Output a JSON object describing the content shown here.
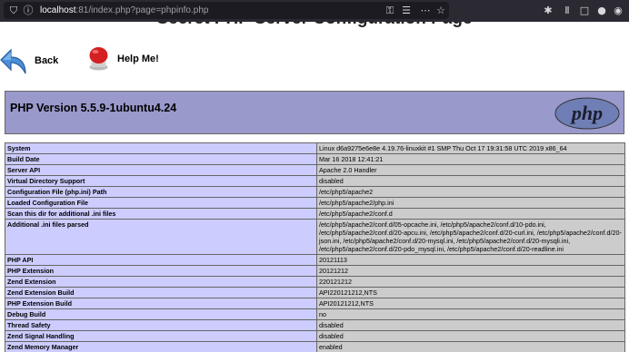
{
  "browser": {
    "url_host": "localhost",
    "url_rest": ":81/index.php?page=phpinfo.php",
    "icons": [
      "shield-icon",
      "info-icon",
      "key-icon",
      "reader-icon",
      "more-icon",
      "star-icon",
      "extensions-icon",
      "library-icon",
      "sidebar-icon",
      "firefox-icon",
      "account-icon"
    ]
  },
  "page": {
    "title": "Secret PHP Server Configuration Page",
    "back_label": "Back",
    "help_label": "Help Me!",
    "version": "PHP Version 5.5.9-1ubuntu4.24",
    "logo_text": "php"
  },
  "info_rows": [
    {
      "key": "System",
      "value": "Linux d6a9275e6e8e 4.19.76-linuxkit #1 SMP Thu Oct 17 19:31:58 UTC 2019 x86_64"
    },
    {
      "key": "Build Date",
      "value": "Mar 16 2018 12:41:21"
    },
    {
      "key": "Server API",
      "value": "Apache 2.0 Handler"
    },
    {
      "key": "Virtual Directory Support",
      "value": "disabled"
    },
    {
      "key": "Configuration File (php.ini) Path",
      "value": "/etc/php5/apache2"
    },
    {
      "key": "Loaded Configuration File",
      "value": "/etc/php5/apache2/php.ini"
    },
    {
      "key": "Scan this dir for additional .ini files",
      "value": "/etc/php5/apache2/conf.d"
    },
    {
      "key": "Additional .ini files parsed",
      "value": "/etc/php5/apache2/conf.d/05-opcache.ini, /etc/php5/apache2/conf.d/10-pdo.ini, /etc/php5/apache2/conf.d/20-apcu.ini, /etc/php5/apache2/conf.d/20-curl.ini, /etc/php5/apache2/conf.d/20-json.ini, /etc/php5/apache2/conf.d/20-mysql.ini, /etc/php5/apache2/conf.d/20-mysqli.ini, /etc/php5/apache2/conf.d/20-pdo_mysql.ini, /etc/php5/apache2/conf.d/20-readline.ini"
    },
    {
      "key": "PHP API",
      "value": "20121113"
    },
    {
      "key": "PHP Extension",
      "value": "20121212"
    },
    {
      "key": "Zend Extension",
      "value": "220121212"
    },
    {
      "key": "Zend Extension Build",
      "value": "API220121212,NTS"
    },
    {
      "key": "PHP Extension Build",
      "value": "API20121212,NTS"
    },
    {
      "key": "Debug Build",
      "value": "no"
    },
    {
      "key": "Thread Safety",
      "value": "disabled"
    },
    {
      "key": "Zend Signal Handling",
      "value": "disabled"
    },
    {
      "key": "Zend Memory Manager",
      "value": "enabled"
    }
  ]
}
